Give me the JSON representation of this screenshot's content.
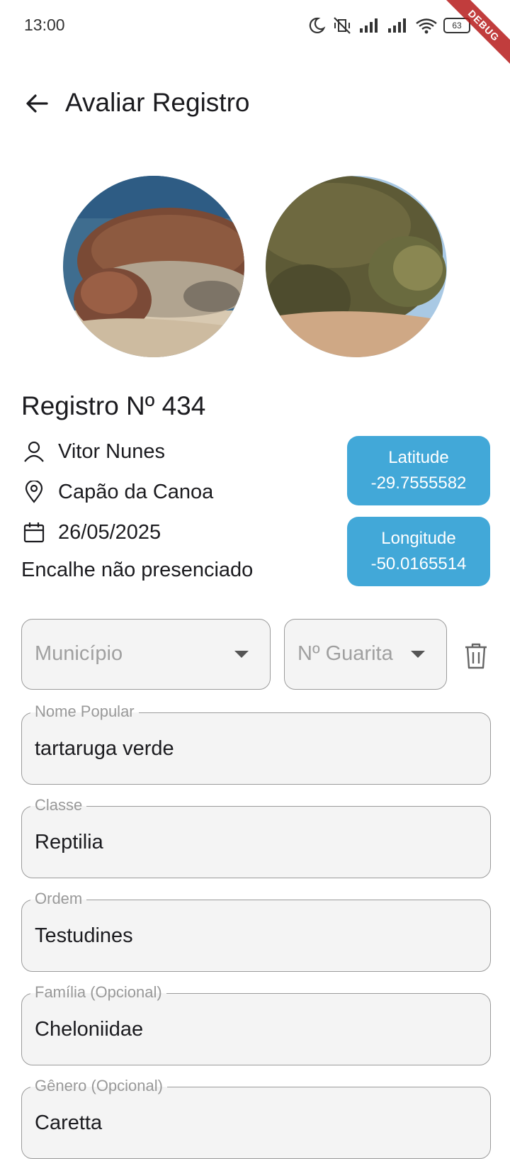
{
  "status_bar": {
    "time": "13:00",
    "battery": "63",
    "debug_banner": "DEBUG"
  },
  "app_bar": {
    "title": "Avaliar Registro"
  },
  "record": {
    "title": "Registro Nº 434",
    "user": "Vitor Nunes",
    "place": "Capão da Canoa",
    "date": "26/05/2025",
    "note": "Encalhe não presenciado"
  },
  "coordinates": {
    "latitude_label": "Latitude",
    "latitude_value": "-29.7555582",
    "longitude_label": "Longitude",
    "longitude_value": "-50.0165514"
  },
  "dropdowns": {
    "municipio_placeholder": "Município",
    "guarita_placeholder": "Nº Guarita"
  },
  "fields": [
    {
      "label": "Nome Popular",
      "value": "tartaruga verde"
    },
    {
      "label": "Classe",
      "value": "Reptilia"
    },
    {
      "label": "Ordem",
      "value": "Testudines"
    },
    {
      "label": "Família (Opcional)",
      "value": "Cheloniidae"
    },
    {
      "label": "Gênero (Opcional)",
      "value": "Caretta"
    }
  ],
  "icons": {
    "back": "arrow-left-icon",
    "user": "person-icon",
    "place": "location-pin-icon",
    "date": "calendar-icon",
    "delete": "trash-icon"
  },
  "colors": {
    "accent": "#42a8d8",
    "field_bg": "#f4f4f4",
    "debug": "#b71c1c"
  }
}
